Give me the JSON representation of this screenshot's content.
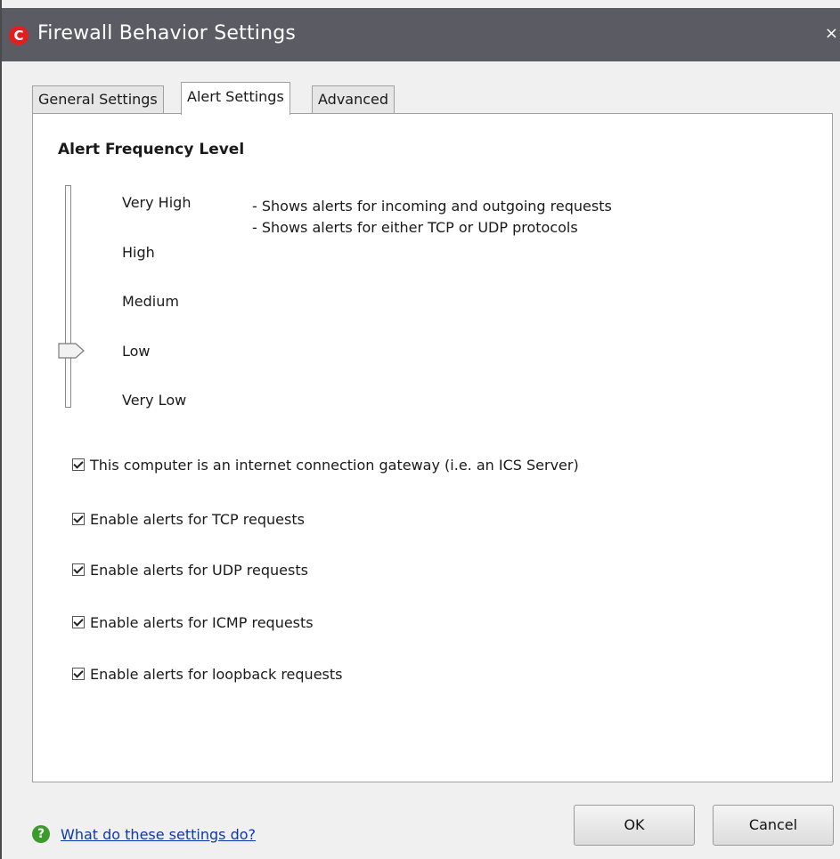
{
  "window": {
    "title": "Firewall Behavior Settings",
    "close_glyph": "×",
    "app_icon_letter": "C"
  },
  "tabs": [
    {
      "label": "General Settings",
      "active": false
    },
    {
      "label": "Alert Settings",
      "active": true
    },
    {
      "label": "Advanced",
      "active": false
    }
  ],
  "alert_frequency": {
    "heading": "Alert Frequency Level",
    "levels": [
      "Very High",
      "High",
      "Medium",
      "Low",
      "Very Low"
    ],
    "selected_level": "Low",
    "descriptions": [
      "- Shows alerts for incoming and outgoing requests",
      "- Shows alerts for either TCP or UDP protocols"
    ]
  },
  "options": [
    {
      "label": "This computer is an internet connection gateway (i.e. an ICS Server)",
      "checked": true
    },
    {
      "label": "Enable alerts for TCP requests",
      "checked": true
    },
    {
      "label": "Enable alerts for UDP requests",
      "checked": true
    },
    {
      "label": "Enable alerts for ICMP requests",
      "checked": true
    },
    {
      "label": "Enable alerts for loopback requests",
      "checked": true
    }
  ],
  "footer": {
    "help_icon": "question-icon",
    "help_glyph": "?",
    "help_link": "What do these settings do?",
    "ok_label": "OK",
    "cancel_label": "Cancel"
  }
}
